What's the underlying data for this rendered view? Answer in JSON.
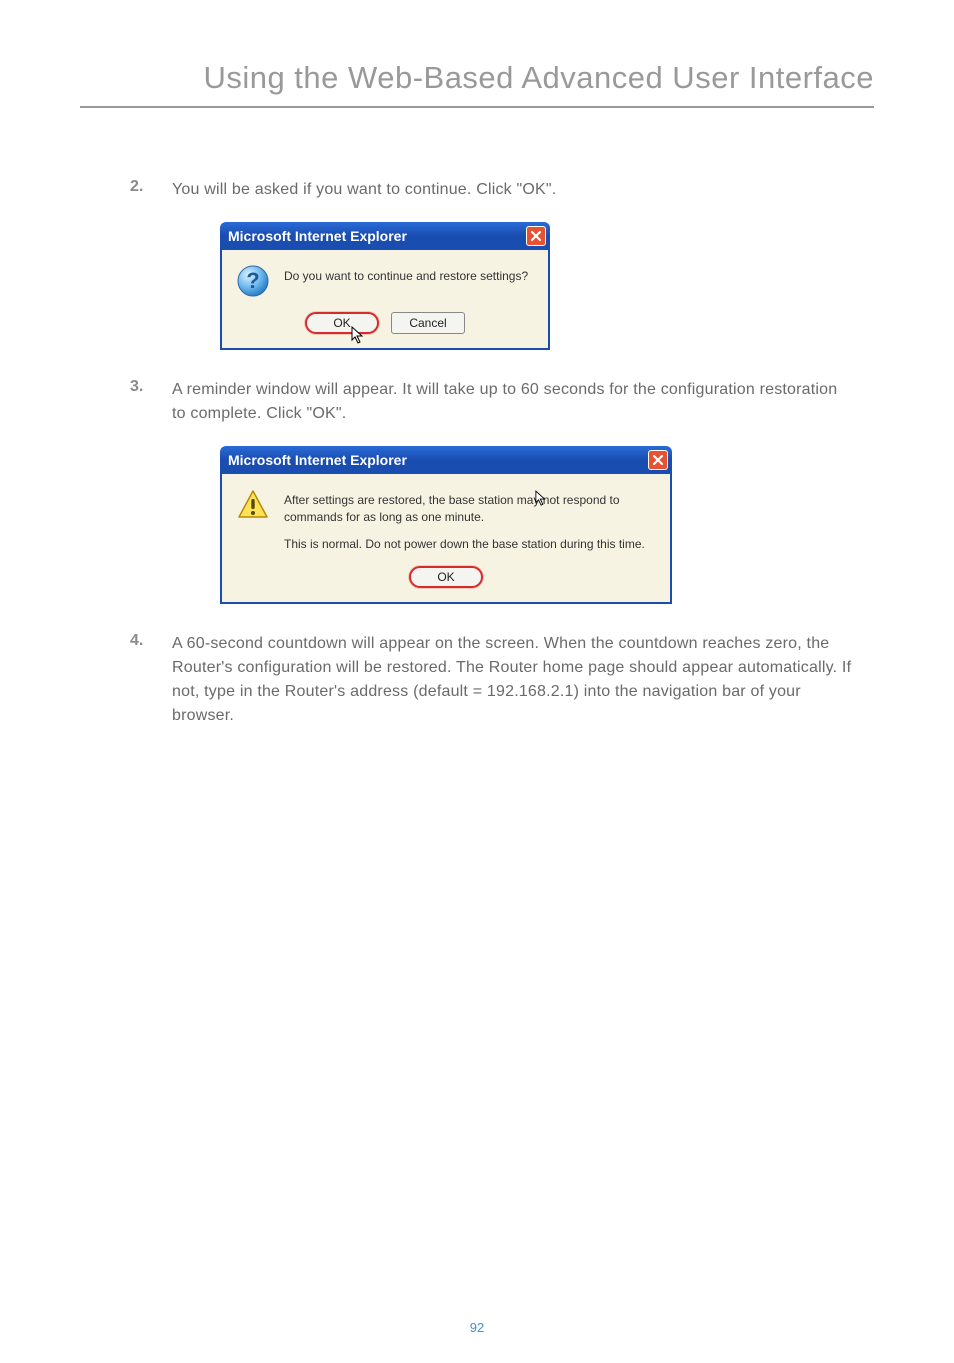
{
  "header": {
    "title": "Using the Web-Based Advanced User Interface"
  },
  "steps": [
    {
      "num": "2.",
      "text": "You will be asked if you want to continue. Click \"OK\"."
    },
    {
      "num": "3.",
      "text": "A reminder window will appear. It will take up to 60 seconds for the configuration restoration to complete. Click \"OK\"."
    },
    {
      "num": "4.",
      "text": "A 60-second countdown will appear on the screen. When the countdown reaches zero, the Router's configuration will be restored. The Router home page should appear automatically. If not, type in the Router's address (default = 192.168.2.1) into the navigation bar of your browser."
    }
  ],
  "dialog1": {
    "title": "Microsoft Internet Explorer",
    "message": "Do you want to continue and restore settings?",
    "ok": "OK",
    "cancel": "Cancel"
  },
  "dialog2": {
    "title": "Microsoft Internet Explorer",
    "line1": "After settings are restored, the base station may not respond to commands for as long as one minute.",
    "line2": "This is normal. Do not power down the base station during this time.",
    "ok": "OK"
  },
  "page_number": "92"
}
